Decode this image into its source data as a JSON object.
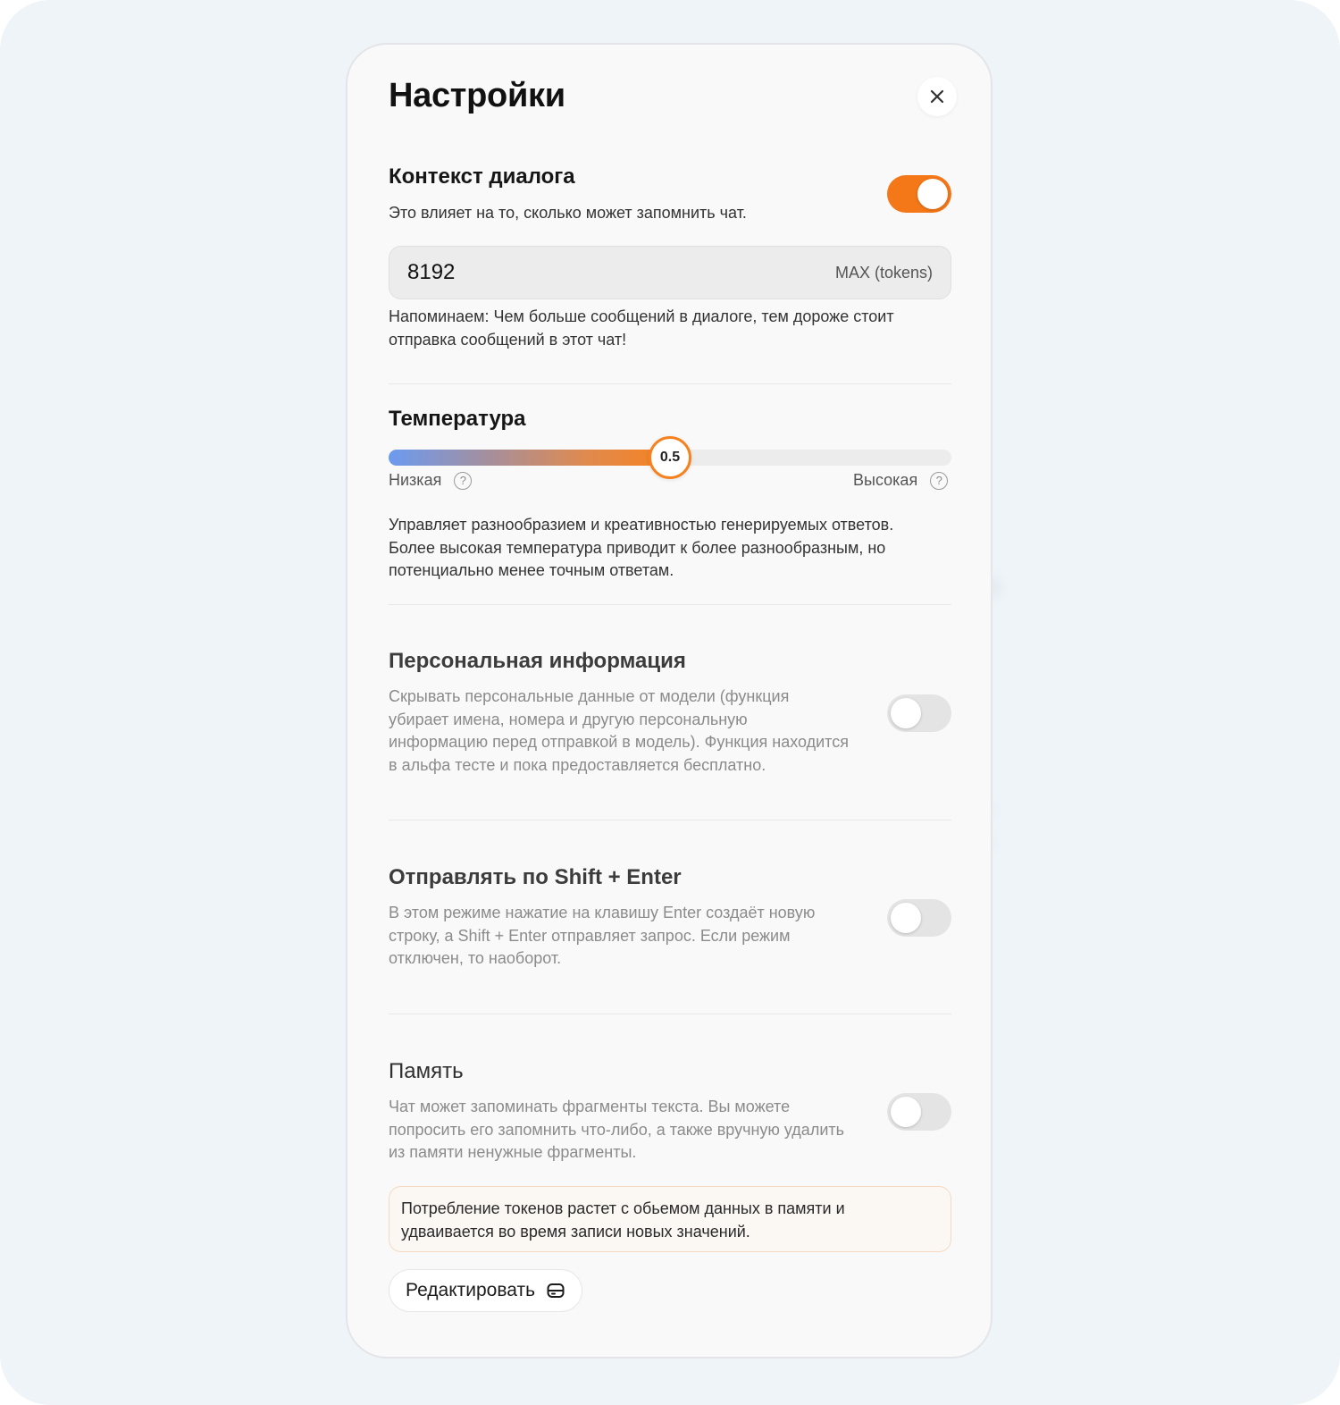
{
  "modal": {
    "title": "Настройки",
    "close_icon": "close-icon"
  },
  "context": {
    "title": "Контекст диалога",
    "description": "Это влияет на то, сколько может запомнить чат.",
    "enabled": true,
    "tokens_value": "8192",
    "tokens_unit": "MAX (tokens)",
    "reminder_line1": "Напоминаем: Чем больше сообщений в диалоге, тем дороже стоит",
    "reminder_line2": "отправка сообщений в этот чат!"
  },
  "temperature": {
    "title": "Температура",
    "value": 0.5,
    "value_label": "0.5",
    "low_label": "Низкая",
    "high_label": "Высокая",
    "help_icon": "question-circle-icon",
    "description_line1": "Управляет разнообразием и креативностью генерируемых ответов.",
    "description_line2": "Более высокая температура приводит к более разнообразным, но",
    "description_line3": "потенциально менее точным ответам."
  },
  "personal_info": {
    "title": "Персональная информация",
    "enabled": false,
    "description_line1": "Скрывать персональные данные от модели (функция",
    "description_line2": "убирает имена, номера и другую персональную",
    "description_line3": "информацию перед отправкой в модель). Функция находится",
    "description_line4": "в альфа тесте и пока предоставляется бесплатно."
  },
  "shift_enter": {
    "title": "Отправлять по Shift + Enter",
    "enabled": false,
    "description_line1": "В этом режиме нажатие на клавишу Enter создаёт новую",
    "description_line2": "строку, а Shift + Enter отправляет запрос. Если режим",
    "description_line3": "отключен, то наоборот."
  },
  "memory": {
    "title": "Память",
    "enabled": false,
    "description_line1": "Чат может запоминать фрагменты текста. Вы можете",
    "description_line2": "попросить его запомнить что-либо, а также вручную удалить",
    "description_line3": "из памяти ненужные фрагменты.",
    "notice_line1": "Потребление токенов растет с обьемом данных в памяти и",
    "notice_line2": "удваивается во время записи новых значений.",
    "edit_label": "Редактировать",
    "edit_icon": "storage-icon"
  },
  "colors": {
    "accent": "#f47718",
    "toggle_off": "#e4e4e4",
    "slider_start": "#6b9bf0",
    "slider_end": "#f5821f"
  }
}
